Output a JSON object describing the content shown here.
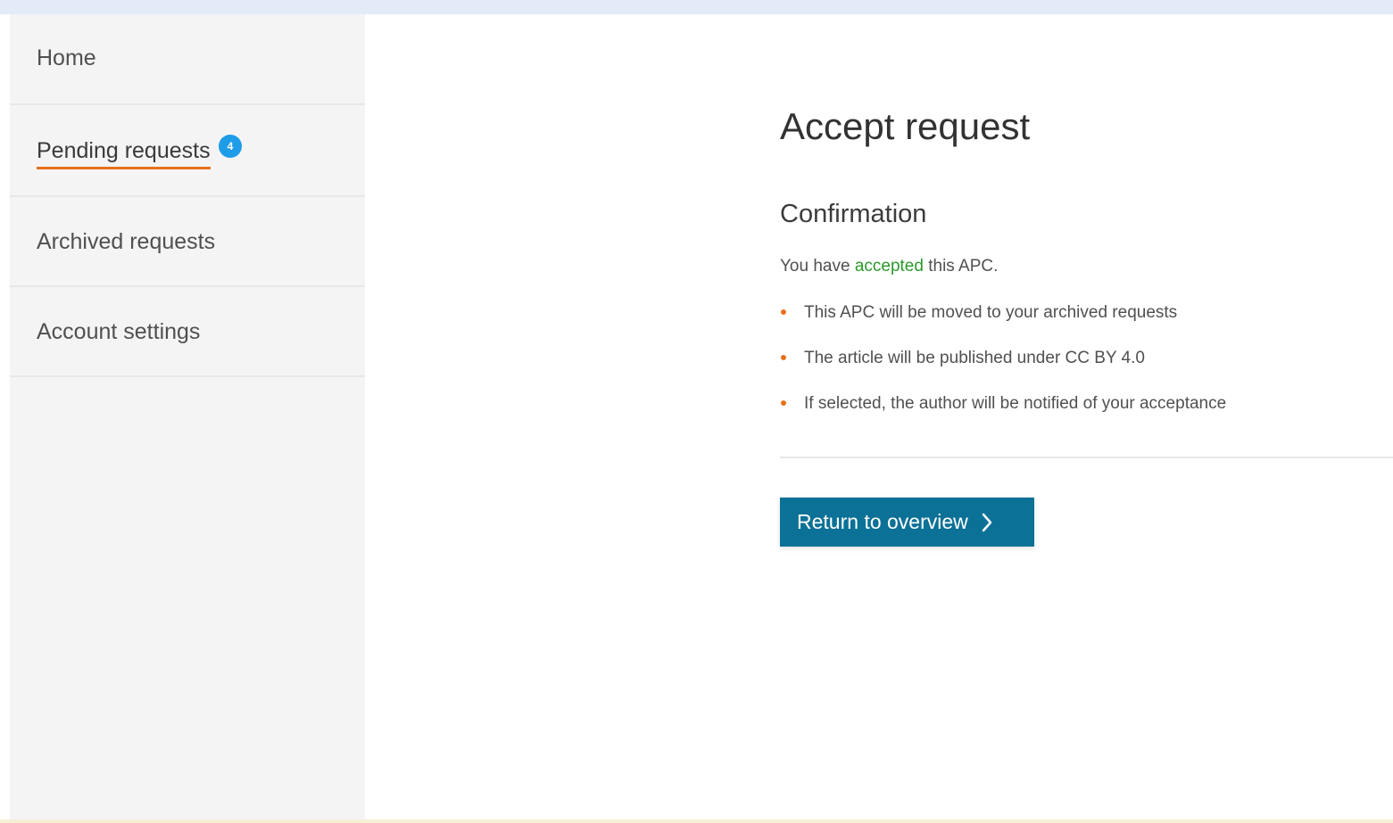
{
  "sidebar": {
    "items": [
      {
        "label": "Home"
      },
      {
        "label": "Pending requests",
        "badge": "4",
        "active": true
      },
      {
        "label": "Archived requests"
      },
      {
        "label": "Account settings"
      }
    ]
  },
  "main": {
    "title": "Accept request",
    "section_title": "Confirmation",
    "message": {
      "before": "You have ",
      "highlight": "accepted",
      "after": " this APC."
    },
    "bullets": [
      "This APC will be moved to your archived requests",
      "The article will be published under CC BY 4.0",
      "If selected, the author will be notified of your acceptance"
    ],
    "return_button_label": "Return to overview"
  },
  "colors": {
    "top_bar": "#e4ebf7",
    "sidebar_bg": "#f4f4f4",
    "active_underline": "#e9711c",
    "badge": "#1f9ce8",
    "accent_text": "#2b9a2b",
    "bullet": "#e9711c",
    "button_bg": "#0c7196"
  },
  "icons": {
    "button_chevron": "chevron-right-icon"
  }
}
